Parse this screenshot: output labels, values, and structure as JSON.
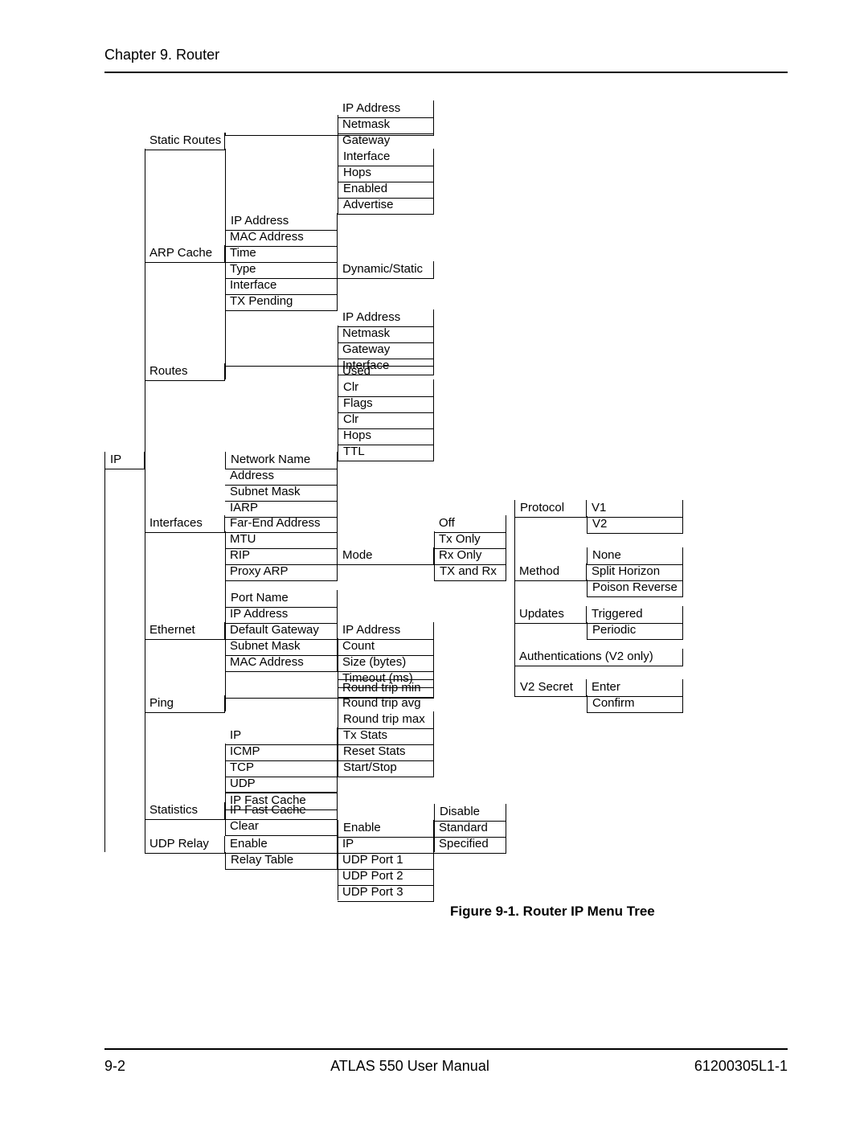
{
  "header": {
    "text": "Chapter 9.  Router"
  },
  "rootLabel": "IP",
  "staticRoutes": {
    "label": "Static Routes",
    "items": [
      "IP Address",
      "Netmask",
      "Gateway",
      "Interface",
      "Hops",
      "Enabled",
      "Advertise"
    ]
  },
  "arpCache": {
    "label": "ARP Cache",
    "items": [
      "IP Address",
      "MAC Address",
      "Time",
      "Type",
      "Interface",
      "TX Pending"
    ],
    "typeValue": "Dynamic/Static"
  },
  "routes": {
    "label": "Routes",
    "items": [
      "IP Address",
      "Netmask",
      "Gateway",
      "Interface",
      "Used",
      "Clr",
      "Flags",
      "Clr",
      "Hops",
      "TTL"
    ]
  },
  "interfaces": {
    "label": "Interfaces",
    "items": [
      "Network Name",
      "Address",
      "Subnet Mask",
      "IARP",
      "Far-End Address",
      "MTU",
      "RIP",
      "Proxy ARP"
    ],
    "ripModeLabel": "Mode",
    "ripModes": [
      "Off",
      "Tx Only",
      "Rx Only",
      "TX and Rx"
    ],
    "ripProtocol": {
      "label": "Protocol",
      "opts": [
        "V1",
        "V2"
      ]
    },
    "ripMethod": {
      "label": "Method",
      "opts": [
        "None",
        "Split Horizon",
        "Poison Reverse"
      ]
    },
    "ripUpdates": {
      "label": "Updates",
      "opts": [
        "Triggered",
        "Periodic"
      ]
    },
    "ripAuth": "Authentications (V2 only)",
    "ripSecret": {
      "label": "V2 Secret",
      "opts": [
        "Enter",
        "Confirm"
      ]
    }
  },
  "ethernet": {
    "label": "Ethernet",
    "items": [
      "Port Name",
      "IP Address",
      "Default Gateway",
      "Subnet Mask",
      "MAC Address"
    ]
  },
  "ping": {
    "label": "Ping",
    "items": [
      "IP Address",
      "Count",
      "Size (bytes)",
      "Timeout (ms)",
      "Round trip min",
      "Round trip avg",
      "Round trip max",
      "Tx Stats",
      "Reset Stats",
      "Start/Stop"
    ]
  },
  "statistics": {
    "label": "Statistics",
    "items": [
      "IP",
      "ICMP",
      "TCP",
      "UDP",
      "IP Fast Cache",
      "Clear"
    ]
  },
  "udpRelay": {
    "label": "UDP Relay",
    "items": [
      "Enable",
      "Relay Table"
    ],
    "enableSub": [
      "Enable",
      "IP",
      "UDP Port 1",
      "UDP Port 2",
      "UDP Port 3"
    ],
    "enableOpts": [
      "Disable",
      "Standard",
      "Specified"
    ]
  },
  "caption": "Figure 9-1.  Router IP Menu Tree",
  "footer": {
    "left": "9-2",
    "center": "ATLAS 550 User Manual",
    "right": "61200305L1-1"
  },
  "chart_data": {
    "type": "table",
    "title": "Router IP Menu Tree",
    "root": "IP",
    "tree": {
      "IP": {
        "Static Routes": [
          "IP Address",
          "Netmask",
          "Gateway",
          "Interface",
          "Hops",
          "Enabled",
          "Advertise"
        ],
        "ARP Cache": {
          "IP Address": null,
          "MAC Address": null,
          "Time": null,
          "Type": "Dynamic/Static",
          "Interface": null,
          "TX Pending": null
        },
        "Routes": [
          "IP Address",
          "Netmask",
          "Gateway",
          "Interface",
          "Used",
          "Clr",
          "Flags",
          "Clr",
          "Hops",
          "TTL"
        ],
        "Interfaces": {
          "Network Name": null,
          "Address": null,
          "Subnet Mask": null,
          "IARP": null,
          "Far-End Address": null,
          "MTU": null,
          "RIP": {
            "Mode": [
              "Off",
              "Tx Only",
              "Rx Only",
              "TX and Rx"
            ],
            "Protocol": [
              "V1",
              "V2"
            ],
            "Method": [
              "None",
              "Split Horizon",
              "Poison Reverse"
            ],
            "Updates": [
              "Triggered",
              "Periodic"
            ],
            "Authentications (V2 only)": null,
            "V2 Secret": [
              "Enter",
              "Confirm"
            ]
          },
          "Proxy ARP": null
        },
        "Ethernet": [
          "Port Name",
          "IP Address",
          "Default Gateway",
          "Subnet Mask",
          "MAC Address"
        ],
        "Ping": [
          "IP Address",
          "Count",
          "Size (bytes)",
          "Timeout (ms)",
          "Round trip min",
          "Round trip avg",
          "Round trip max",
          "Tx Stats",
          "Reset Stats",
          "Start/Stop"
        ],
        "Statistics": [
          "IP",
          "ICMP",
          "TCP",
          "UDP",
          "IP Fast Cache",
          "Clear"
        ],
        "UDP Relay": {
          "Enable": {
            "Enable": [
              "Disable",
              "Standard",
              "Specified"
            ],
            "IP": null,
            "UDP Port 1": null,
            "UDP Port 2": null,
            "UDP Port 3": null
          },
          "Relay Table": null
        }
      }
    }
  }
}
